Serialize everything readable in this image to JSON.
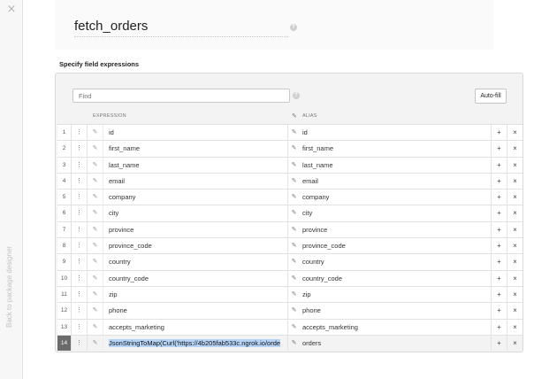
{
  "sidebar": {
    "close_glyph": "×",
    "back_label": "Back to package designer",
    "close_icon": "close-icon"
  },
  "component": {
    "name": "fetch_orders",
    "help_glyph": "?"
  },
  "section": {
    "title": "Specify field expressions"
  },
  "toolbar": {
    "find_placeholder": "Find",
    "find_help_glyph": "?",
    "autofill_label": "Auto-fill"
  },
  "columns": {
    "expression": "EXPRESSION",
    "alias": "ALIAS"
  },
  "icons": {
    "drag": "⋮",
    "edit": "✎",
    "alias_edit": "✎",
    "add": "+",
    "remove": "×"
  },
  "rows": [
    {
      "num": "1",
      "expression": "id",
      "alias": "id"
    },
    {
      "num": "2",
      "expression": "first_name",
      "alias": "first_name"
    },
    {
      "num": "3",
      "expression": "last_name",
      "alias": "last_name"
    },
    {
      "num": "4",
      "expression": "email",
      "alias": "email"
    },
    {
      "num": "5",
      "expression": "company",
      "alias": "company"
    },
    {
      "num": "6",
      "expression": "city",
      "alias": "city"
    },
    {
      "num": "7",
      "expression": "province",
      "alias": "province"
    },
    {
      "num": "8",
      "expression": "province_code",
      "alias": "province_code"
    },
    {
      "num": "9",
      "expression": "country",
      "alias": "country"
    },
    {
      "num": "10",
      "expression": "country_code",
      "alias": "country_code"
    },
    {
      "num": "11",
      "expression": "zip",
      "alias": "zip"
    },
    {
      "num": "12",
      "expression": "phone",
      "alias": "phone"
    },
    {
      "num": "13",
      "expression": "accepts_marketing",
      "alias": "accepts_marketing"
    },
    {
      "num": "14",
      "expression": "JsonStringToMap(Curl('https://4b205fab533c.ngrok.io/orde",
      "alias": "orders",
      "selected": true
    }
  ],
  "colors": {
    "selection": "#b6d4f7",
    "selected_row_number": "#6b6b6b"
  }
}
